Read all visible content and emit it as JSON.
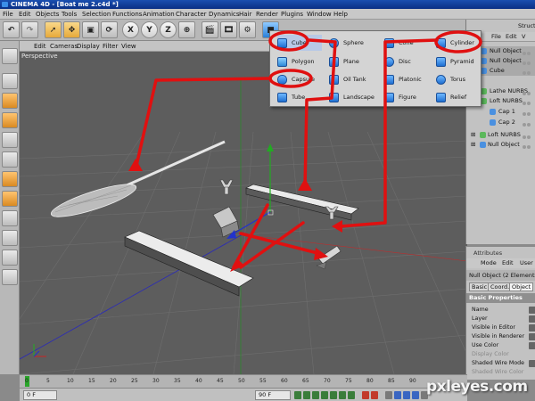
{
  "window": {
    "title": "CINEMA 4D - [Boat me 2.c4d *]"
  },
  "menubar": {
    "items": [
      "File",
      "Edit",
      "Objects",
      "Tools",
      "Selection",
      "Functions",
      "Animation",
      "Character",
      "Dynamics",
      "Hair",
      "Render",
      "Plugins",
      "Window",
      "Help"
    ]
  },
  "toolbar": {
    "icons": [
      "undo-icon",
      "redo-icon",
      "live-select-icon",
      "move-icon",
      "scale-icon",
      "rotate-icon",
      "x-axis-icon",
      "y-axis-icon",
      "z-axis-icon",
      "world-coord-icon",
      "render-view-icon",
      "render-picture-icon",
      "render-settings-icon",
      "cube-icon"
    ],
    "axis_labels": [
      "X",
      "Y",
      "Z"
    ]
  },
  "viewport": {
    "menus": [
      "Edit",
      "Cameras",
      "Display",
      "Filter",
      "View"
    ],
    "camera_label": "Perspective"
  },
  "primitives_menu": {
    "columns": [
      [
        "Cube",
        "Polygon",
        "Capsule",
        "Tube"
      ],
      [
        "Sphere",
        "Plane",
        "Oil Tank",
        "Landscape"
      ],
      [
        "Cone",
        "Disc",
        "Platonic",
        "Figure"
      ],
      [
        "Cylinder",
        "Pyramid",
        "Torus",
        "Relief"
      ]
    ],
    "circled": [
      "Cube",
      "Capsule",
      "Cylinder"
    ]
  },
  "object_manager": {
    "tab_label": "Structure",
    "menus": [
      "File",
      "Edit",
      "V"
    ],
    "rows": [
      {
        "label": "Null Object",
        "indent": 1,
        "selected": true
      },
      {
        "label": "Null Object",
        "indent": 1,
        "selected": true
      },
      {
        "label": "Cube",
        "indent": 1,
        "selected": true
      },
      {
        "label": "Lathe NURBS",
        "indent": 1,
        "selected": false
      },
      {
        "label": "Loft NURBS",
        "indent": 1,
        "selected": false
      },
      {
        "label": "Cap 1",
        "indent": 2,
        "selected": false
      },
      {
        "label": "Cap 2",
        "indent": 2,
        "selected": false
      },
      {
        "label": "Loft NURBS",
        "indent": 0,
        "selected": false
      },
      {
        "label": "Null Object",
        "indent": 0,
        "selected": false
      }
    ]
  },
  "attribute_manager": {
    "tab_label": "Attributes",
    "menus": [
      "Mode",
      "Edit",
      "User"
    ],
    "object_name": "Null Object (2 Elements)",
    "subtabs": [
      "Basic",
      "Coord.",
      "Object"
    ],
    "active_subtab": "Object",
    "section": "Basic Properties",
    "properties": [
      {
        "label": "Name",
        "disabled": false
      },
      {
        "label": "Layer",
        "disabled": false
      },
      {
        "label": "Visible in Editor",
        "disabled": false
      },
      {
        "label": "Visible in Renderer",
        "disabled": false
      },
      {
        "label": "Use Color",
        "disabled": false
      },
      {
        "label": "Display Color",
        "disabled": true
      },
      {
        "label": "Shaded Wire Mode",
        "disabled": false
      },
      {
        "label": "Shaded Wire Color",
        "disabled": true
      }
    ]
  },
  "timeline": {
    "ticks": [
      "0",
      "5",
      "10",
      "15",
      "20",
      "25",
      "30",
      "35",
      "40",
      "45",
      "50",
      "55",
      "60",
      "65",
      "70",
      "75",
      "80",
      "85",
      "90"
    ],
    "start_frame": "0 F",
    "end_frame": "90 F"
  },
  "watermark": "pxleyes.com",
  "colors": {
    "annotation_red": "#e01010",
    "viewport_bg": "#5d5d5d",
    "titlebar_blue": "#0a2f85",
    "accent_orange": "#e6a93a"
  }
}
